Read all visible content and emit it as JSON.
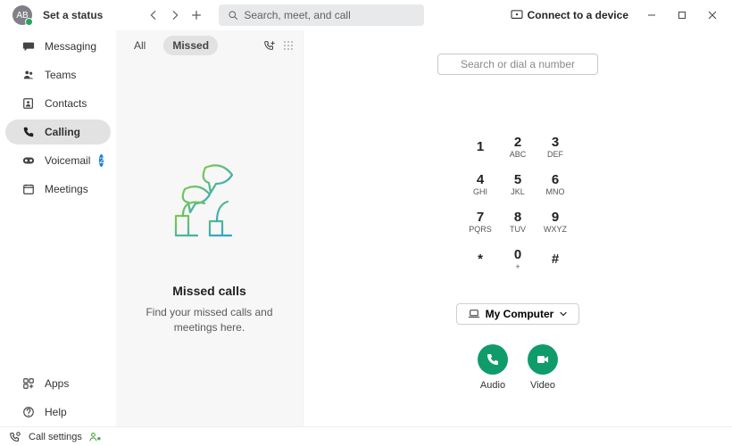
{
  "header": {
    "avatar_initials": "AB",
    "status_text": "Set a status",
    "search_placeholder": "Search, meet, and call",
    "connect_label": "Connect to a device"
  },
  "sidebar": {
    "items": [
      {
        "label": "Messaging"
      },
      {
        "label": "Teams"
      },
      {
        "label": "Contacts"
      },
      {
        "label": "Calling"
      },
      {
        "label": "Voicemail",
        "badge": "2"
      },
      {
        "label": "Meetings"
      }
    ],
    "bottom": [
      {
        "label": "Apps"
      },
      {
        "label": "Help"
      }
    ]
  },
  "call_list": {
    "tab_all": "All",
    "tab_missed": "Missed",
    "empty_title": "Missed calls",
    "empty_sub": "Find your missed calls and meetings here."
  },
  "dial": {
    "placeholder": "Search or dial a number",
    "keys": [
      {
        "num": "1",
        "sub": ""
      },
      {
        "num": "2",
        "sub": "ABC"
      },
      {
        "num": "3",
        "sub": "DEF"
      },
      {
        "num": "4",
        "sub": "GHI"
      },
      {
        "num": "5",
        "sub": "JKL"
      },
      {
        "num": "6",
        "sub": "MNO"
      },
      {
        "num": "7",
        "sub": "PQRS"
      },
      {
        "num": "8",
        "sub": "TUV"
      },
      {
        "num": "9",
        "sub": "WXYZ"
      },
      {
        "num": "*",
        "sub": ""
      },
      {
        "num": "0",
        "sub": "+"
      },
      {
        "num": "#",
        "sub": ""
      }
    ],
    "device_label": "My Computer",
    "audio_label": "Audio",
    "video_label": "Video"
  },
  "status": {
    "call_settings": "Call settings"
  }
}
